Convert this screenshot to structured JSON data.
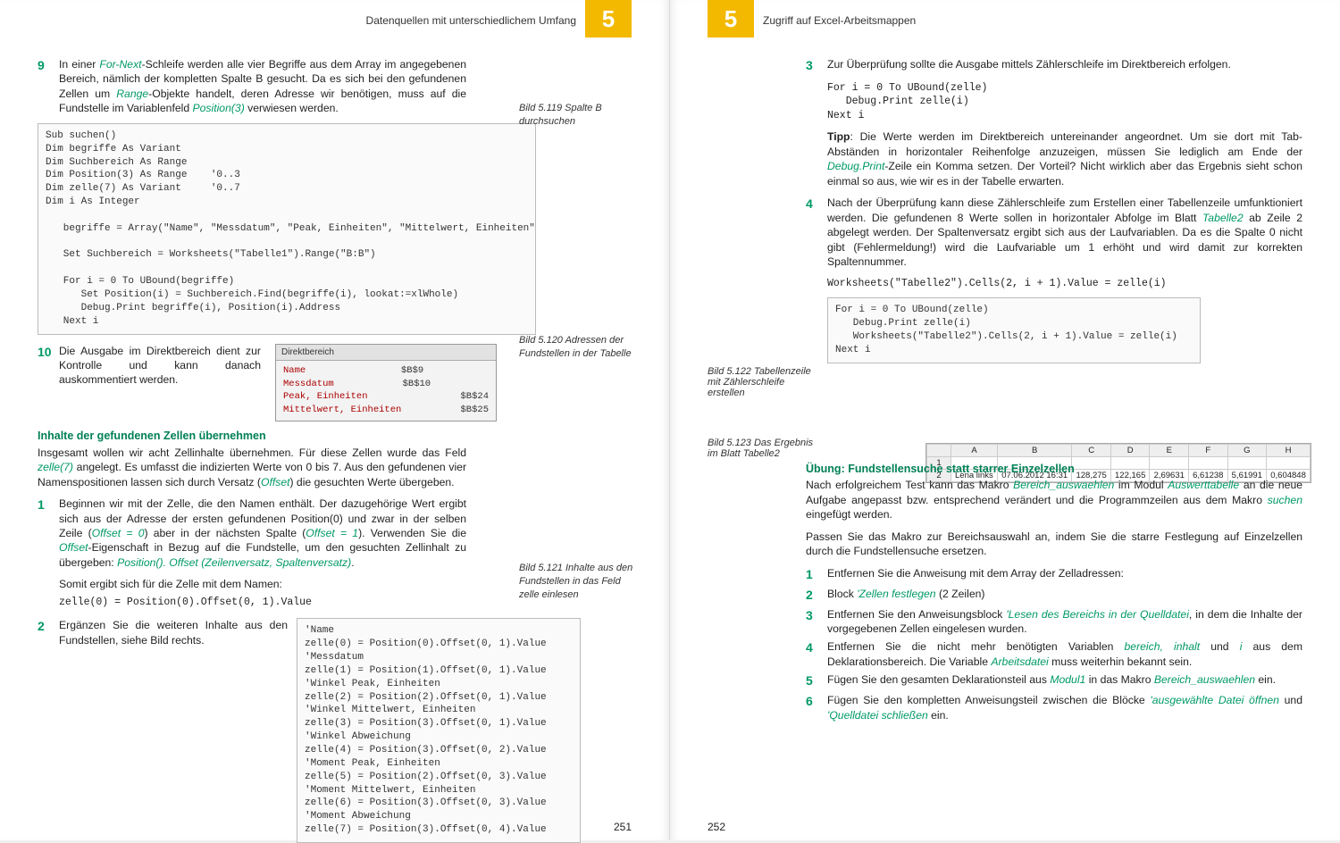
{
  "left": {
    "chapter_num": "5",
    "running_title": "Datenquellen mit unterschiedlichem Umfang",
    "page_num": "251",
    "step9_num": "9",
    "step9_txt_a": "In einer ",
    "step9_txt_b": "For-Next",
    "step9_txt_c": "-Schleife werden alle vier Begriffe aus dem Array im angegebenen Bereich, nämlich der kompletten Spalte B gesucht. Da es sich bei den gefundenen Zellen um ",
    "step9_txt_d": "Range",
    "step9_txt_e": "-Objekte handelt, deren Adresse wir benötigen, muss auf die Fundstelle im Variablenfeld ",
    "step9_txt_f": "Position(3)",
    "step9_txt_g": " verwiesen werden.",
    "caption119": "Bild 5.119 Spalte B durchsuchen",
    "code1": "Sub suchen()\nDim begriffe As Variant\nDim Suchbereich As Range\nDim Position(3) As Range    '0..3\nDim zelle(7) As Variant     '0..7\nDim i As Integer\n\n   begriffe = Array(\"Name\", \"Messdatum\", \"Peak, Einheiten\", \"Mittelwert, Einheiten\")\n\n   Set Suchbereich = Worksheets(\"Tabelle1\").Range(\"B:B\")\n\n   For i = 0 To UBound(begriffe)\n      Set Position(i) = Suchbereich.Find(begriffe(i), lookat:=xlWhole)\n      Debug.Print begriffe(i), Position(i).Address\n   Next i",
    "step10_num": "10",
    "step10_txt": "Die Ausgabe im Direktbereich dient zur Kontrolle und kann danach auskommentiert werden.",
    "caption120": "Bild 5.120 Adressen der Fundstellen in der Tabelle",
    "direkt_title": "Direktbereich",
    "direkt_rows": [
      [
        "Name",
        "$B$9"
      ],
      [
        "Messdatum",
        "$B$10"
      ],
      [
        "Peak, Einheiten",
        "$B$24"
      ],
      [
        "Mittelwert, Einheiten",
        "$B$25"
      ]
    ],
    "subhead1": "Inhalte der gefundenen Zellen übernehmen",
    "para1_a": "Insgesamt wollen wir acht Zellinhalte übernehmen. Für diese Zellen wurde das Feld ",
    "para1_b": "zelle(7)",
    "para1_c": " angelegt. Es umfasst die indizierten Werte von 0 bis 7. Aus den gefundenen vier Namenspositionen lassen sich durch Versatz (",
    "para1_d": "Offset",
    "para1_e": ") die gesuchten Werte übergeben.",
    "step1_num": "1",
    "step1_a": "Beginnen wir mit der Zelle, die den Namen enthält. Der dazugehörige Wert ergibt sich aus der Adresse der ersten gefundenen Position(0) und zwar in der selben Zeile (",
    "step1_b": "Offset = 0",
    "step1_c": ") aber in der nächsten Spalte (",
    "step1_d": "Offset = 1",
    "step1_e": "). Verwenden Sie die ",
    "step1_f": "Offset",
    "step1_g": "-Eigenschaft in Bezug auf die Fundstelle, um den gesuchten Zellinhalt zu übergeben: ",
    "step1_h": "Position(). Offset (Zeilenversatz, Spaltenversatz)",
    "step1_i": ".",
    "somit": "Somit ergibt sich für die Zelle mit dem Namen:",
    "codeline1": "zelle(0) = Position(0).Offset(0, 1).Value",
    "step2_num": "2",
    "step2_txt": "Ergänzen Sie die weiteren Inhalte aus den Fundstellen, siehe Bild rechts.",
    "caption121": "Bild 5.121 Inhalte aus den Fundstellen in das Feld zelle einlesen",
    "code2": "'Name\nzelle(0) = Position(0).Offset(0, 1).Value\n'Messdatum\nzelle(1) = Position(1).Offset(0, 1).Value\n'Winkel Peak, Einheiten\nzelle(2) = Position(2).Offset(0, 1).Value\n'Winkel Mittelwert, Einheiten\nzelle(3) = Position(3).Offset(0, 1).Value\n'Winkel Abweichung\nzelle(4) = Position(3).Offset(0, 2).Value\n'Moment Peak, Einheiten\nzelle(5) = Position(2).Offset(0, 3).Value\n'Moment Mittelwert, Einheiten\nzelle(6) = Position(3).Offset(0, 3).Value\n'Moment Abweichung\nzelle(7) = Position(3).Offset(0, 4).Value"
  },
  "right": {
    "chapter_num": "5",
    "running_title": "Zugriff auf Excel-Arbeitsmappen",
    "page_num": "252",
    "step3_num": "3",
    "step3_txt": "Zur Überprüfung sollte die Ausgabe mittels Zählerschleife im Direktbereich erfolgen.",
    "code_a": "For i = 0 To UBound(zelle)\n   Debug.Print zelle(i)\nNext i",
    "tipp_a": "Tipp",
    "tipp_b": ": Die Werte werden im Direktbereich untereinander angeordnet. Um sie dort mit Tab-Abständen in horizontaler Reihenfolge anzuzeigen, müssen Sie lediglich am Ende der ",
    "tipp_c": "Debug.Print",
    "tipp_d": "-Zeile ein Komma setzen. Der Vorteil? Nicht wirklich aber das Ergebnis sieht schon einmal so aus, wie wir es in der Tabelle erwarten.",
    "step4_num": "4",
    "step4_a": "Nach der Überprüfung kann diese Zählerschleife zum Erstellen einer Tabellenzeile umfunktioniert werden. Die gefundenen 8 Werte sollen in horizontaler Abfolge im Blatt ",
    "step4_b": "Tabelle2",
    "step4_c": " ab Zeile 2 abgelegt werden. Der Spaltenversatz ergibt sich aus der Laufvariablen. Da es die Spalte 0 nicht gibt (Fehlermeldung!) wird die Laufvariable um 1 erhöht und wird damit zur korrekten Spaltennummer.",
    "codeline_ws": "Worksheets(\"Tabelle2\").Cells(2, i + 1).Value = zelle(i)",
    "caption122": "Bild 5.122 Tabellenzeile mit Zählerschleife erstellen",
    "code_b": "For i = 0 To UBound(zelle)\n   Debug.Print zelle(i)\n   Worksheets(\"Tabelle2\").Cells(2, i + 1).Value = zelle(i)\nNext i",
    "caption123": "Bild 5.123 Das Ergebnis im Blatt Tabelle2",
    "sheet_cols": [
      "",
      "A",
      "B",
      "C",
      "D",
      "E",
      "F",
      "G",
      "H"
    ],
    "sheet_row1": [
      "1",
      "",
      "",
      "",
      "",
      "",
      "",
      "",
      ""
    ],
    "sheet_row2": [
      "2",
      "Lena links",
      "07.06.2012 16:31",
      "128,275",
      "122,165",
      "2,69631",
      "6,61238",
      "5,61991",
      "0,604848"
    ],
    "subhead2": "Übung: Fundstellensuche statt starrer Einzelzellen",
    "para2_a": "Nach erfolgreichem Test kann das Makro ",
    "para2_b": "Bereich_auswaehlen",
    "para2_c": " im Modul ",
    "para2_d": "Auswerttabelle",
    "para2_e": " an die neue Aufgabe angepasst bzw. entsprechend verändert und die Programmzeilen aus dem Makro ",
    "para2_f": "suchen",
    "para2_g": " eingefügt werden.",
    "para3": "Passen Sie das Makro zur Bereichsauswahl an, indem Sie die starre Festlegung auf Einzelzellen durch die Fundstellensuche ersetzen.",
    "r1_num": "1",
    "r1_txt": "Entfernen Sie die Anweisung mit dem Array der Zelladressen:",
    "r2_num": "2",
    "r2_a": "Block ",
    "r2_b": "'Zellen festlegen",
    "r2_c": " (2 Zeilen)",
    "r3_num": "3",
    "r3_a": "Entfernen Sie den Anweisungsblock ",
    "r3_b": "'Lesen des Bereichs in der Quelldatei",
    "r3_c": ", in dem die Inhalte der vorgegebenen Zellen eingelesen wurden.",
    "r4_num": "4",
    "r4_a": "Entfernen Sie die nicht mehr benötigten Variablen ",
    "r4_b": "bereich, inhalt",
    "r4_c": " und ",
    "r4_d": "i",
    "r4_e": " aus dem Deklarationsbereich. Die Variable ",
    "r4_f": "Arbeitsdatei",
    "r4_g": " muss weiterhin bekannt sein.",
    "r5_num": "5",
    "r5_a": "Fügen Sie den gesamten Deklarationsteil aus ",
    "r5_b": "Modul1",
    "r5_c": " in das Makro ",
    "r5_d": "Bereich_auswaehlen",
    "r5_e": " ein.",
    "r6_num": "6",
    "r6_a": "Fügen Sie den kompletten Anweisungsteil zwischen die Blöcke ",
    "r6_b": "'ausgewählte Datei öffnen",
    "r6_c": " und ",
    "r6_d": "'Quelldatei schließen",
    "r6_e": " ein."
  }
}
